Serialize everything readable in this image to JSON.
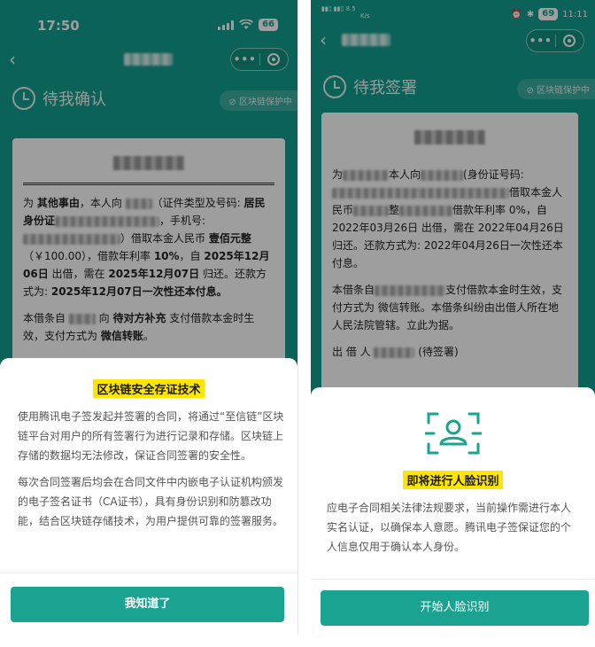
{
  "left": {
    "status_time": "17:50",
    "battery": "66",
    "status": "待我确认",
    "chain_tag": "区块链保护中",
    "doc": {
      "p1": [
        {
          "t": "为 ",
          "b": false
        },
        {
          "t": "其他事由",
          "b": true
        },
        {
          "t": "，本人向 ",
          "b": false
        },
        {
          "blur": 30
        },
        {
          "t": "（证件类型及号码: ",
          "b": false
        },
        {
          "t": "居民身份证",
          "b": true
        },
        {
          "blur": 118
        },
        {
          "t": "，手机号:",
          "b": false
        },
        {
          "blur": 110
        },
        {
          "t": "）借取本金人民币 ",
          "b": false
        },
        {
          "t": "壹佰元整",
          "b": true
        },
        {
          "t": "（￥100.00），借款年利率 ",
          "b": false
        },
        {
          "t": "10%",
          "b": true
        },
        {
          "t": "，自 ",
          "b": false
        },
        {
          "t": "2025年12月06日",
          "b": true
        },
        {
          "t": " 出借，需在 ",
          "b": false
        },
        {
          "t": "2025年12月07日",
          "b": true
        },
        {
          "t": " 归还。还款方式为: ",
          "b": false
        },
        {
          "t": "2025年12月07日一次性还本付息。",
          "b": true
        }
      ],
      "p2": [
        {
          "t": "本借条自 ",
          "b": false
        },
        {
          "blur": 30
        },
        {
          "t": " 向 ",
          "b": false
        },
        {
          "t": "待对方补充",
          "b": true
        },
        {
          "t": " 支付借款本金时生效，支付方式为 ",
          "b": false
        },
        {
          "t": "微信转账",
          "b": true
        },
        {
          "t": "。",
          "b": false
        }
      ]
    },
    "sheet": {
      "title": "区块链安全存证技术",
      "para1": "使用腾讯电子签发起并签署的合同，将通过“至信链”区块链平台对用户的所有签署行为进行记录和存储。区块链上存储的数据均无法修改，保证合同签署的安全性。",
      "para2": "每次合同签署后均会在合同文件中内嵌电子认证机构颁发的电子签名证书（CA证书），具有身份识别和防篡改功能，结合区块链存储技术，为用户提供可靠的签署服务。",
      "button": "我知道了"
    }
  },
  "right": {
    "status_time": "11:11",
    "battery": "69",
    "net_speed": "8.5",
    "net_unit": "K/s",
    "status": "待我签署",
    "chain_tag": "区块链保护中",
    "doc": {
      "p1": [
        {
          "t": "为",
          "b": false
        },
        {
          "blur": 52
        },
        {
          "t": "本人向",
          "b": false
        },
        {
          "blur": 48
        },
        {
          "t": "(身份证号码:",
          "b": false
        },
        {
          "blur": 100
        },
        {
          "blur": 100
        },
        {
          "t": "借取本金人民币",
          "b": false
        },
        {
          "blur": 40
        },
        {
          "t": "整",
          "b": false
        },
        {
          "blur": 60
        },
        {
          "t": "借款年利率 0%，自 2022年03月26日 出借，需在 2022年04月26日 归还。还款方式为: 2022年04月26日一次性还本付息。",
          "b": false
        }
      ],
      "p2": [
        {
          "t": "本借条自",
          "b": false
        },
        {
          "blur": 80
        },
        {
          "t": "支付借款本金时生效，支付方式为 微信转账。本借条纠纷由出借人所在地人民法院管辖。立此为据。",
          "b": false
        }
      ],
      "lender_label": "出 借 人",
      "pending": "(待签署)"
    },
    "sheet": {
      "title": "即将进行人脸识别",
      "body": "应电子合同相关法律法规要求，当前操作需进行本人实名认证，以确保本人意愿。腾讯电子签保证您的个人信息仅用于确认本人身份。",
      "button": "开始人脸识别"
    }
  },
  "colors": {
    "brand": "#139e8e",
    "button": "#1ba392",
    "highlight": "#ffe600"
  }
}
